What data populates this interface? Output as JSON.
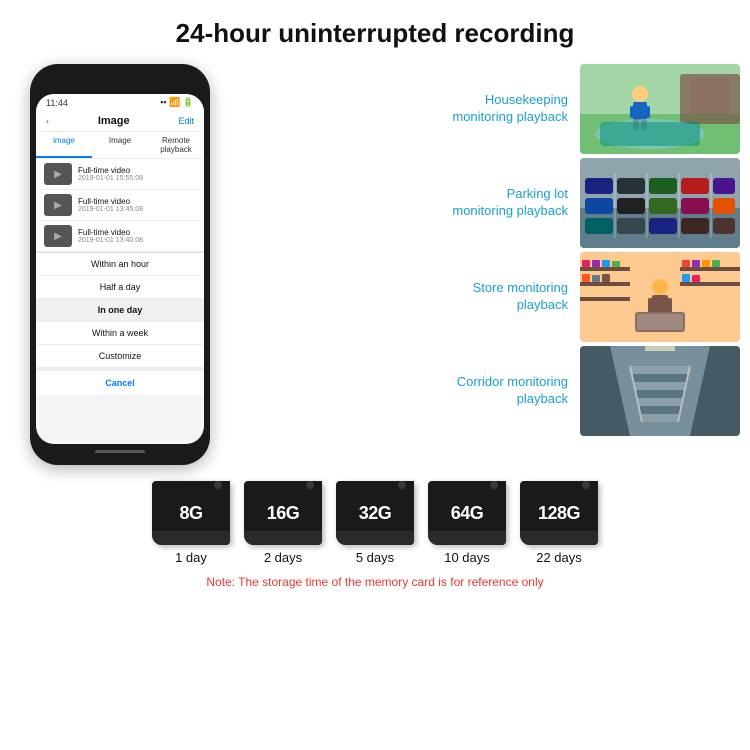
{
  "header": {
    "title": "24-hour uninterrupted recording"
  },
  "phone": {
    "time": "11:44",
    "screen_title": "Image",
    "edit_btn": "Edit",
    "back_btn": "‹",
    "tabs": [
      "image",
      "Image",
      "Remote playback"
    ],
    "list_items": [
      {
        "title": "Full-time video",
        "date": "2019-01-01 15:55:08"
      },
      {
        "title": "Full-time video",
        "date": "2019-01-01 13:45:08"
      },
      {
        "title": "Full-time video",
        "date": "2019-01-01 13:40:08"
      }
    ],
    "dropdown_items": [
      "Within an hour",
      "Half a day",
      "In one day",
      "Within a week",
      "Customize"
    ],
    "selected_item": "In one day",
    "cancel_btn": "Cancel"
  },
  "monitoring": {
    "items": [
      {
        "label": "Housekeeping\nmonitoring playback",
        "image_type": "housekeeping",
        "emoji": "🧒"
      },
      {
        "label": "Parking lot\nmonitoring playback",
        "image_type": "parking",
        "emoji": "🚗"
      },
      {
        "label": "Store monitoring\nplayback",
        "image_type": "store",
        "emoji": "🏪"
      },
      {
        "label": "Corridor monitoring\nplayback",
        "image_type": "corridor",
        "emoji": "🏢"
      }
    ]
  },
  "storage": {
    "cards": [
      {
        "size": "8G",
        "days": "1 day"
      },
      {
        "size": "16G",
        "days": "2 days"
      },
      {
        "size": "32G",
        "days": "5 days"
      },
      {
        "size": "64G",
        "days": "10 days"
      },
      {
        "size": "128G",
        "days": "22 days"
      }
    ],
    "note": "Note: The storage time of the memory card is for reference only"
  },
  "colors": {
    "accent_blue": "#1a9fd4",
    "note_red": "#e53935",
    "phone_bg": "#1a1a1a",
    "card_bg": "#1a1a1a"
  }
}
